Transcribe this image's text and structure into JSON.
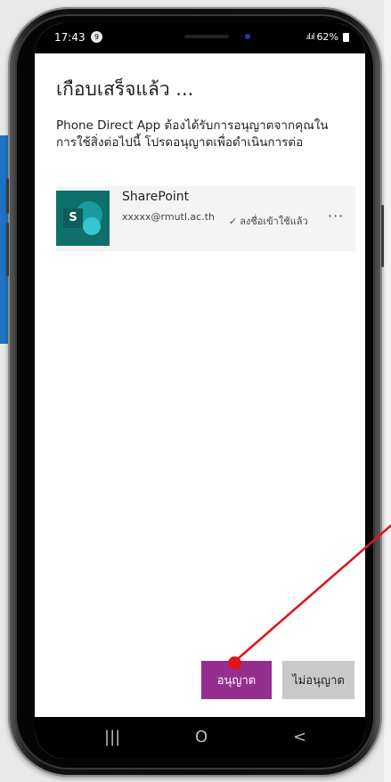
{
  "statusbar": {
    "time": "17:43",
    "notification_count": "9",
    "signal": ".ıl.ıl",
    "battery_percent": "62%"
  },
  "dialog": {
    "title": "เกือบเสร็จแล้ว ...",
    "description": "Phone Direct App ต้องได้รับการอนุญาตจากคุณในการใช้สิ่งต่อไปนี้ โปรดอนุญาตเพื่อดำเนินการต่อ"
  },
  "account_card": {
    "app_name": "SharePoint",
    "icon_letter": "S",
    "email": "xxxxx@rmutl.ac.th",
    "status_check": "✓",
    "status": "ลงชื่อเข้าใช้แล้ว",
    "more_label": "···"
  },
  "buttons": {
    "accept": "อนุญาต",
    "decline": "ไม่อนุญาต"
  },
  "navbar": {
    "recents": "|||",
    "home": "O",
    "back": "<"
  },
  "colors": {
    "accept": "#962e8f",
    "decline": "#c9c9c9",
    "pointer": "#e0141c",
    "icon_bg": "#0e6f6b"
  },
  "icons": [
    "sharepoint-icon",
    "check-icon",
    "more-icon",
    "recents-icon",
    "home-icon",
    "back-icon"
  ]
}
